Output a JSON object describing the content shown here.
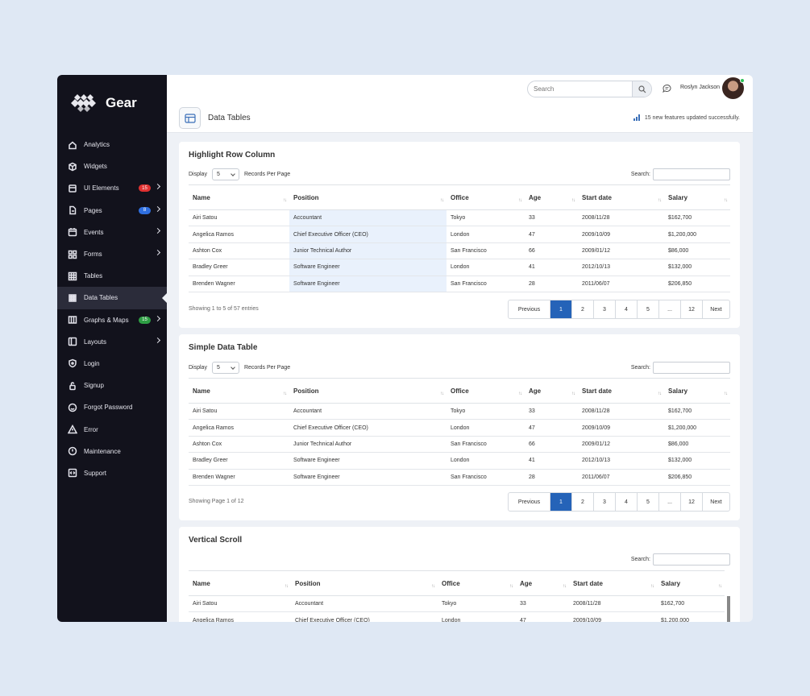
{
  "brand": {
    "name": "Gear"
  },
  "sidebar": {
    "items": [
      {
        "label": "Analytics",
        "icon": "home-icon"
      },
      {
        "label": "Widgets",
        "icon": "cube-icon"
      },
      {
        "label": "UI Elements",
        "icon": "layers-icon",
        "badge": "15",
        "badge_color": "#e03131",
        "chevron": true
      },
      {
        "label": "Pages",
        "icon": "file-icon",
        "badge": "8",
        "badge_color": "#2f6fe0",
        "chevron": true
      },
      {
        "label": "Events",
        "icon": "calendar-icon",
        "chevron": true
      },
      {
        "label": "Forms",
        "icon": "grid-icon",
        "chevron": true
      },
      {
        "label": "Tables",
        "icon": "table-icon"
      },
      {
        "label": "Data Tables",
        "icon": "dots-grid-icon",
        "active": true
      },
      {
        "label": "Graphs & Maps",
        "icon": "map-icon",
        "badge": "15",
        "badge_color": "#2e9e44",
        "chevron": true
      },
      {
        "label": "Layouts",
        "icon": "layout-icon",
        "chevron": true
      },
      {
        "label": "Login",
        "icon": "shield-icon"
      },
      {
        "label": "Signup",
        "icon": "lock-icon"
      },
      {
        "label": "Forgot Password",
        "icon": "smile-icon"
      },
      {
        "label": "Error",
        "icon": "warning-icon"
      },
      {
        "label": "Maintenance",
        "icon": "info-icon"
      },
      {
        "label": "Support",
        "icon": "code-icon"
      }
    ]
  },
  "header": {
    "search_placeholder": "Search",
    "user_name": "Roslyn Jackson",
    "page_title": "Data Tables",
    "notice": "15 new features updated successfully."
  },
  "columns": [
    "Name",
    "Position",
    "Office",
    "Age",
    "Start date",
    "Salary"
  ],
  "rows": [
    [
      "Airi Satou",
      "Accountant",
      "Tokyo",
      "33",
      "2008/11/28",
      "$162,700"
    ],
    [
      "Angelica Ramos",
      "Chief Executive Officer (CEO)",
      "London",
      "47",
      "2009/10/09",
      "$1,200,000"
    ],
    [
      "Ashton Cox",
      "Junior Technical Author",
      "San Francisco",
      "66",
      "2009/01/12",
      "$86,000"
    ],
    [
      "Bradley Greer",
      "Software Engineer",
      "London",
      "41",
      "2012/10/13",
      "$132,000"
    ],
    [
      "Brenden Wagner",
      "Software Engineer",
      "San Francisco",
      "28",
      "2011/06/07",
      "$206,850"
    ]
  ],
  "common": {
    "display_label": "Display",
    "records_label": "Records Per Page",
    "page_size": "5",
    "search_label": "Search:",
    "pager": [
      "Previous",
      "1",
      "2",
      "3",
      "4",
      "5",
      "...",
      "12",
      "Next"
    ]
  },
  "card1": {
    "title": "Highlight Row Column",
    "showing": "Showing 1 to 5 of 57 entries"
  },
  "card2": {
    "title": "Simple Data Table",
    "showing": "Showing Page 1 of 12"
  },
  "card3": {
    "title": "Vertical Scroll"
  }
}
